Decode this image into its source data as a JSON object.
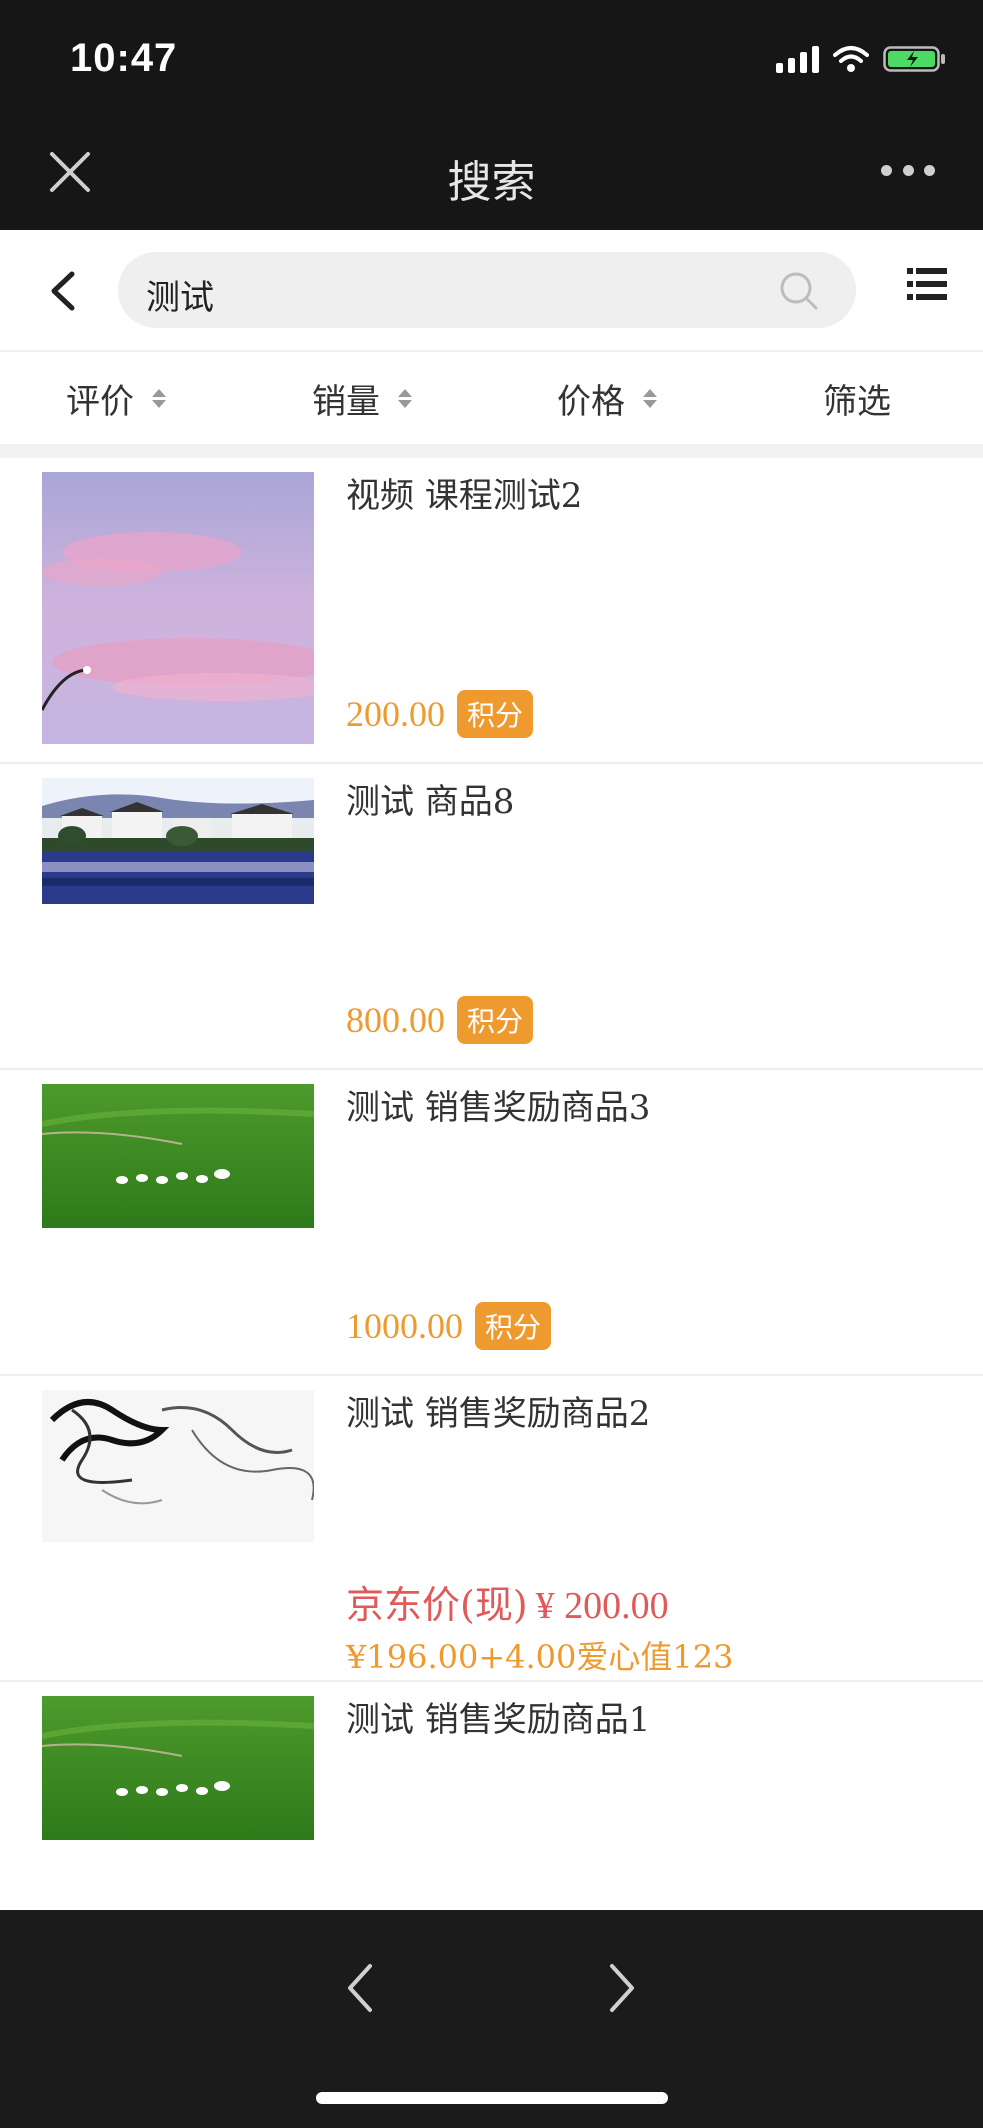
{
  "status_bar": {
    "time": "10:47"
  },
  "title_bar": {
    "title": "搜索"
  },
  "search": {
    "query": "测试"
  },
  "sort_bar": {
    "items": [
      "评价",
      "销量",
      "价格",
      "筛选"
    ]
  },
  "products": [
    {
      "title": "视频 课程测试2",
      "price": "200.00",
      "badge": "积分",
      "image": "pink-sky-photo"
    },
    {
      "title": "测试 商品8",
      "price": "800.00",
      "badge": "积分",
      "image": "lakeside-village-photo"
    },
    {
      "title": "测试 销售奖励商品3",
      "price": "1000.00",
      "badge": "积分",
      "image": "grassland-photo"
    },
    {
      "title": "测试 销售奖励商品2",
      "jd_label": "京东价(现)",
      "jd_price": "¥ 200.00",
      "mix_price": "¥196.00+4.00爱心值123",
      "image": "ink-smoke-photo"
    },
    {
      "title": "测试 销售奖励商品1",
      "image": "grassland-photo"
    }
  ],
  "colors": {
    "accent": "#ef9a2f",
    "jd_red": "#e05a5a",
    "dark_bar": "#161616"
  }
}
